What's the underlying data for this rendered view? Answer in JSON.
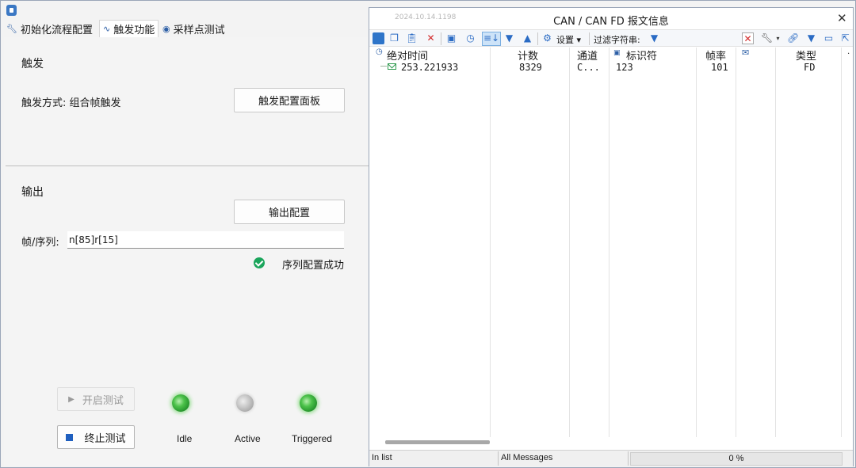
{
  "tabs": [
    {
      "label": "初始化流程配置",
      "icon": "wrench-icon"
    },
    {
      "label": "触发功能",
      "icon": "wave-icon"
    },
    {
      "label": "采样点测试",
      "icon": "disc-icon"
    }
  ],
  "trigger": {
    "section_title": "触发",
    "mode_label": "触发方式: 组合帧触发",
    "panel_button": "触发配置面板"
  },
  "output": {
    "section_title": "输出",
    "config_button": "输出配置",
    "sequence_label": "帧/序列:",
    "sequence_value": "n[85]r[15]",
    "status_text": "序列配置成功"
  },
  "test": {
    "start_button": "开启测试",
    "stop_button": "终止测试",
    "indicators": [
      {
        "label": "Idle",
        "state": "on"
      },
      {
        "label": "Active",
        "state": "off"
      },
      {
        "label": "Triggered",
        "state": "on"
      }
    ]
  },
  "can_window": {
    "title": "CAN / CAN FD 报文信息",
    "date_stamp": "2024.10.14.1198",
    "toolbar": {
      "settings_label": "设置",
      "filter_label": "过滤字符串:"
    },
    "columns": [
      "绝对时间",
      "计数",
      "通道",
      "标识符",
      "帧率",
      "类型"
    ],
    "rows": [
      {
        "time": "253.221933",
        "count": "8329",
        "channel": "C...",
        "id": "123",
        "rate": "101",
        "type": "FD"
      }
    ],
    "status": {
      "in_list": "In list",
      "messages": "All Messages",
      "progress": "0 %"
    }
  },
  "colors": {
    "accent": "#2d74c9",
    "success": "#1aa55b",
    "led_on": "#4cc24a",
    "error": "#d32a2a"
  }
}
